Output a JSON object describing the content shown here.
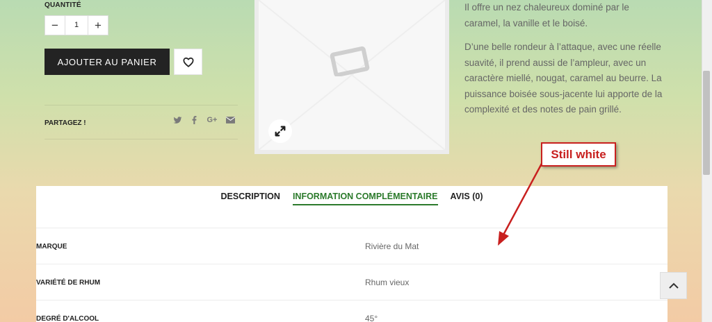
{
  "product": {
    "quantity_label": "QUANTITÉ",
    "quantity_value": "1",
    "decrement": "−",
    "increment": "+",
    "add_to_cart": "AJOUTER AU PANIER",
    "share_label": "PARTAGEZ !",
    "share_icons": [
      "twitter-icon",
      "facebook-icon",
      "google-plus-icon",
      "email-icon"
    ]
  },
  "description": {
    "para1": "Il offre un nez chaleureux dominé par le caramel, la vanille et le boisé.",
    "para2": "D’une belle rondeur à l’attaque, avec une réelle suavité, il prend aussi de l’ampleur, avec un caractère miellé, nougat, caramel au beurre. La puissance boisée sous-jacente lui apporte de la complexité et des notes de pain grillé."
  },
  "annotation": {
    "text": "Still white",
    "color": "#c8201f"
  },
  "tabs": [
    {
      "label": "DESCRIPTION",
      "active": false
    },
    {
      "label": "INFORMATION COMPLÉMENTAIRE",
      "active": true
    },
    {
      "label": "AVIS (0)",
      "active": false
    }
  ],
  "attributes": [
    {
      "key": "MARQUE",
      "value": "Rivière du Mat"
    },
    {
      "key": "VARIÉTÉ DE RHUM",
      "value": "Rhum vieux"
    },
    {
      "key": "DEGRÉ D'ALCOOL",
      "value": "45°"
    }
  ],
  "colors": {
    "accent_green": "#2b7a2b",
    "button_dark": "#232323"
  }
}
